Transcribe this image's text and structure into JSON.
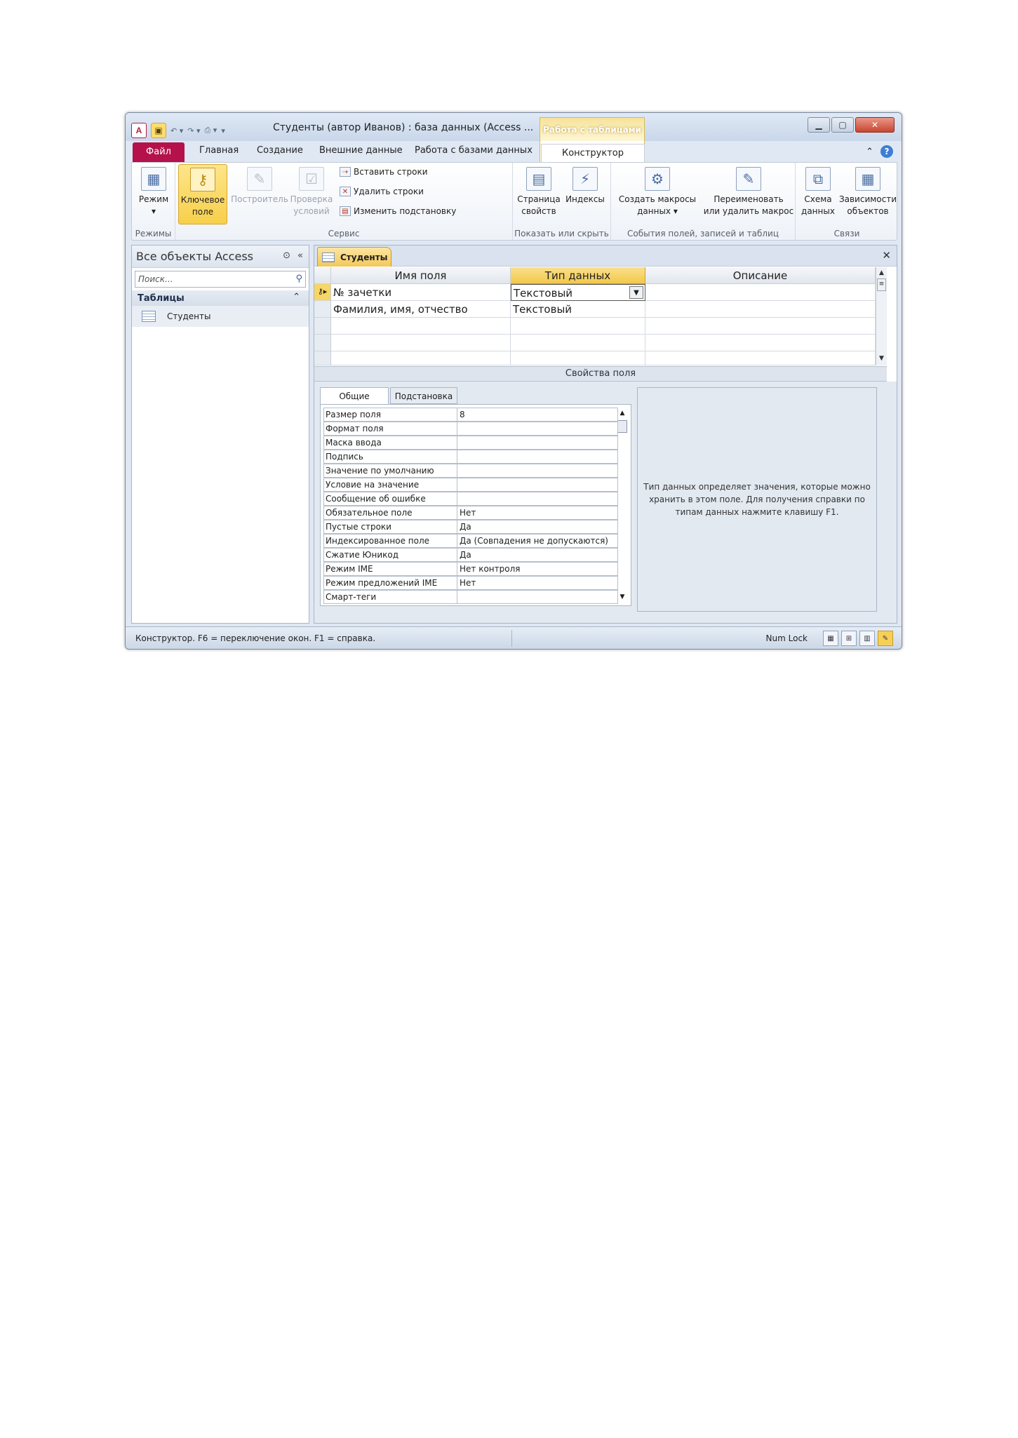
{
  "window": {
    "title": "Студенты (автор Иванов) : база данных (Access ...",
    "context_group": "Работа с таблицами",
    "app_icon": "A",
    "quick_access": [
      "save-icon",
      "undo-icon",
      "redo-icon",
      "print-preview-icon",
      "customize-icon"
    ]
  },
  "tabs": {
    "file": "Файл",
    "items": [
      "Главная",
      "Создание",
      "Внешние данные",
      "Работа с базами данных"
    ],
    "active": "Конструктор"
  },
  "ribbon": {
    "groups": {
      "modes": "Режимы",
      "service": "Сервис",
      "show_hide": "Показать или скрыть",
      "events": "События полей, записей и таблиц",
      "relations": "Связи"
    },
    "mode": "Режим",
    "key_field": {
      "l1": "Ключевое",
      "l2": "поле"
    },
    "builder": "Построитель",
    "check": {
      "l1": "Проверка",
      "l2": "условий"
    },
    "insert_rows": "Вставить строки",
    "delete_rows": "Удалить строки",
    "change_lookup": "Изменить подстановку",
    "property_sheet": {
      "l1": "Страница",
      "l2": "свойств"
    },
    "indexes": "Индексы",
    "create_macros": {
      "l1": "Создать макросы",
      "l2": "данных ▾"
    },
    "rename_macro": {
      "l1": "Переименовать",
      "l2": "или удалить макрос"
    },
    "schema": {
      "l1": "Схема",
      "l2": "данных"
    },
    "deps": {
      "l1": "Зависимости",
      "l2": "объектов"
    }
  },
  "nav": {
    "header": "Все объекты Access",
    "search_placeholder": "Поиск...",
    "section": "Таблицы",
    "items": [
      "Студенты"
    ]
  },
  "doc": {
    "tab": "Студенты",
    "columns": [
      "Имя поля",
      "Тип данных",
      "Описание"
    ],
    "rows": [
      {
        "name": "№ зачетки",
        "type": "Текстовый",
        "desc": ""
      },
      {
        "name": "Фамилия, имя, отчество",
        "type": "Текстовый",
        "desc": ""
      }
    ],
    "props_title": "Свойства поля"
  },
  "props": {
    "tabs": [
      "Общие",
      "Подстановка"
    ],
    "rows": [
      {
        "label": "Размер поля",
        "value": "8"
      },
      {
        "label": "Формат поля",
        "value": ""
      },
      {
        "label": "Маска ввода",
        "value": ""
      },
      {
        "label": "Подпись",
        "value": ""
      },
      {
        "label": "Значение по умолчанию",
        "value": ""
      },
      {
        "label": "Условие на значение",
        "value": ""
      },
      {
        "label": "Сообщение об ошибке",
        "value": ""
      },
      {
        "label": "Обязательное поле",
        "value": "Нет"
      },
      {
        "label": "Пустые строки",
        "value": "Да"
      },
      {
        "label": "Индексированное поле",
        "value": "Да (Совпадения не допускаются)"
      },
      {
        "label": "Сжатие Юникод",
        "value": "Да"
      },
      {
        "label": "Режим IME",
        "value": "Нет контроля"
      },
      {
        "label": "Режим предложений IME",
        "value": "Нет"
      },
      {
        "label": "Смарт-теги",
        "value": ""
      }
    ],
    "hint": "Тип данных определяет значения, которые можно хранить в этом поле. Для получения справки по типам данных нажмите клавишу F1."
  },
  "status": {
    "left": "Конструктор.  F6 = переключение окон.  F1 = справка.",
    "numlock": "Num Lock"
  }
}
